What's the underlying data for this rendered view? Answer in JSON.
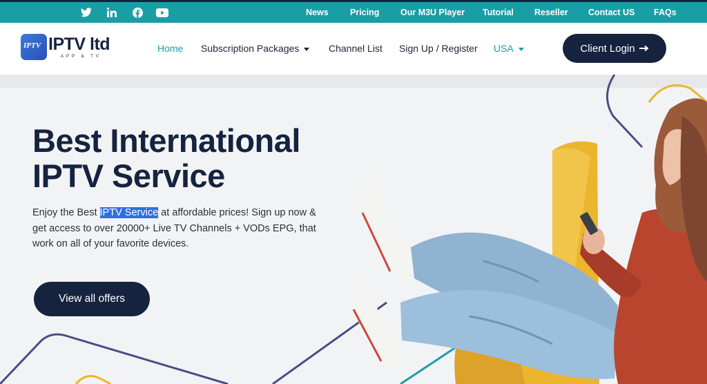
{
  "topbar": {
    "social": [
      {
        "name": "twitter",
        "icon": "twitter-icon"
      },
      {
        "name": "linkedin",
        "icon": "linkedin-icon"
      },
      {
        "name": "facebook",
        "icon": "facebook-icon"
      },
      {
        "name": "youtube",
        "icon": "youtube-icon"
      }
    ],
    "links": [
      "News",
      "Pricing",
      "Our M3U Player",
      "Tutorial",
      "Reseller",
      "Contact US",
      "FAQs"
    ]
  },
  "header": {
    "logo": {
      "badge": "IPTV",
      "name": "IPTV ltd",
      "sub": "APP & TV"
    },
    "nav": {
      "home": "Home",
      "packages": "Subscription Packages",
      "channels": "Channel List",
      "signup": "Sign Up / Register",
      "region": "USA"
    },
    "login": "Client Login"
  },
  "hero": {
    "title_line1": "Best International",
    "title_line2": "IPTV Service",
    "desc_before": "Enjoy the Best ",
    "desc_highlight": "IPTV Service",
    "desc_after": " at affordable prices! Sign up now & get access to over 20000+ Live TV Channels + VODs EPG, that work on all of your favorite devices.",
    "cta": "View all offers"
  },
  "colors": {
    "teal": "#1a9ea6",
    "navy": "#16233f",
    "highlight": "#2f6fe0",
    "chair": "#ecb52e",
    "sweater": "#b9452f",
    "jeans": "#8fb3d1"
  }
}
